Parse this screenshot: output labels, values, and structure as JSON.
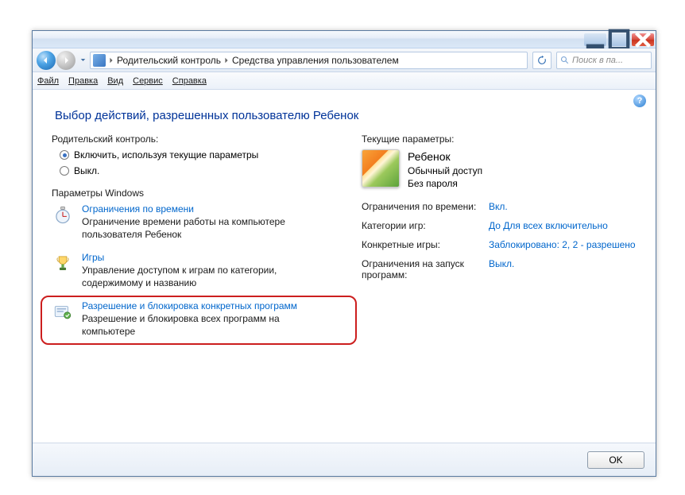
{
  "breadcrumb": {
    "item1": "Родительский контроль",
    "item2": "Средства управления пользователем"
  },
  "search": {
    "placeholder": "Поиск в па..."
  },
  "menu": {
    "file": "Файл",
    "edit": "Правка",
    "view": "Вид",
    "tools": "Сервис",
    "help": "Справка"
  },
  "page": {
    "title": "Выбор действий, разрешенных пользователю Ребенок"
  },
  "left": {
    "section1": "Родительский контроль:",
    "radio_on": "Включить, используя текущие параметры",
    "radio_off": "Выкл.",
    "section2": "Параметры Windows",
    "opt1_title": "Ограничения по времени",
    "opt1_desc": "Ограничение времени работы на компьютере пользователя Ребенок",
    "opt2_title": "Игры",
    "opt2_desc": "Управление доступом к играм по категории, содержимому и названию",
    "opt3_title": "Разрешение и блокировка конкретных программ",
    "opt3_desc": "Разрешение и блокировка всех программ на компьютере"
  },
  "right": {
    "section": "Текущие параметры:",
    "user_name": "Ребенок",
    "user_role": "Обычный доступ",
    "user_pw": "Без пароля",
    "p1l": "Ограничения по времени:",
    "p1v": "Вкл.",
    "p2l": "Категории игр:",
    "p2v": "До Для всех включительно",
    "p3l": "Конкретные игры:",
    "p3v": "Заблокировано: 2, 2 - разрешено",
    "p4l": "Ограничения на запуск программ:",
    "p4v": "Выкл."
  },
  "footer": {
    "ok": "OK"
  }
}
